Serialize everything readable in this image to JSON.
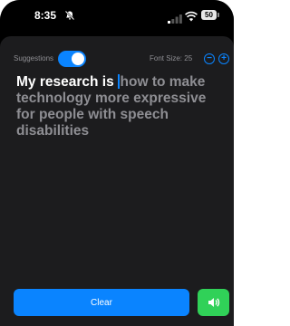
{
  "status_bar": {
    "time": "8:35",
    "battery": "50",
    "icons": [
      "bell-slash-icon",
      "cellular-signal-icon",
      "wifi-icon",
      "battery-icon"
    ]
  },
  "toolbar": {
    "suggestions_label": "Suggestions",
    "suggestions_enabled": true,
    "font_size_label": "Font Size: 25",
    "minus_label": "−",
    "plus_label": "+"
  },
  "message": {
    "typed": "My research is",
    "suggestion": "how to make technology more expressive for people with speech disabilities"
  },
  "actions": {
    "clear_label": "Clear",
    "speak_icon": "speaker-icon"
  },
  "colors": {
    "accent": "#0a84ff",
    "speak": "#30d158",
    "background": "#1c1c1e",
    "suggestion_text": "#8e8e93"
  }
}
